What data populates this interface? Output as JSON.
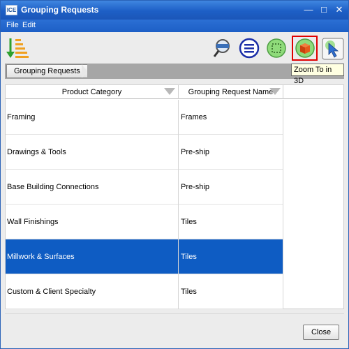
{
  "window": {
    "title": "Grouping Requests",
    "icon_text": "ICE"
  },
  "menu": [
    "File",
    "Edit"
  ],
  "toolbar": {
    "icons": [
      "sort-order-icon",
      "zoom-search-icon",
      "list-menu-icon",
      "select-area-icon",
      "zoom-to-3d-icon",
      "pointer-cursor-icon"
    ],
    "tooltip": "Zoom To in 3D",
    "highlight_color": "#e00000"
  },
  "breadcrumb": [
    "Grouping Requests"
  ],
  "table": {
    "columns": [
      "Product Category",
      "Grouping Request Name"
    ],
    "rows": [
      [
        "Framing",
        "Frames"
      ],
      [
        "Drawings & Tools",
        "Pre-ship"
      ],
      [
        "Base Building Connections",
        "Pre-ship"
      ],
      [
        "Wall Finishings",
        "Tiles"
      ],
      [
        "Millwork & Surfaces",
        "Tiles"
      ],
      [
        "Custom & Client Specialty",
        "Tiles"
      ]
    ],
    "selected_row": 4,
    "selection_color": "#0e5cc3"
  },
  "footer": {
    "close_label": "Close"
  }
}
